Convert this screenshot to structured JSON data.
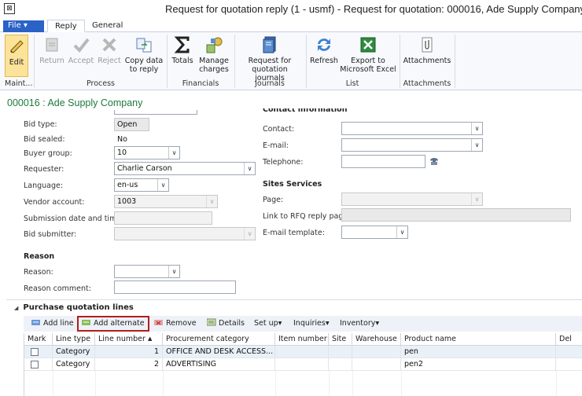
{
  "window": {
    "title": "Request for quotation reply (1 - usmf) - Request for quotation: 000016, Ade Supply Company",
    "sys_icon": "⊠"
  },
  "ribbon_tabs": {
    "file": "File",
    "file_arrow": "▾",
    "reply": "Reply",
    "general": "General"
  },
  "ribbon": {
    "edit": "Edit",
    "return": "Return",
    "accept": "Accept",
    "reject": "Reject",
    "copy_data": "Copy data",
    "copy_data_2": "to reply",
    "totals": "Totals",
    "manage": "Manage",
    "manage_2": "charges",
    "rfq_journals": "Request for",
    "rfq_journals_2": "quotation journals",
    "refresh": "Refresh",
    "export": "Export to",
    "export_2": "Microsoft Excel",
    "attachments": "Attachments",
    "groups": {
      "maint": "Maint...",
      "process": "Process",
      "financials": "Financials",
      "journals": "Journals",
      "list": "List",
      "attachments": "Attachments"
    }
  },
  "record_header": "000016 : Ade Supply Company",
  "form": {
    "bid_type_label": "Bid type:",
    "bid_type": "Open",
    "bid_sealed_label": "Bid sealed:",
    "bid_sealed": "No",
    "buyer_group_label": "Buyer group:",
    "buyer_group": "10",
    "requester_label": "Requester:",
    "requester": "Charlie Carson",
    "language_label": "Language:",
    "language": "en-us",
    "vendor_account_label": "Vendor account:",
    "vendor_account": "1003",
    "submission_label": "Submission date and time:",
    "submission": "",
    "bid_submitter_label": "Bid submitter:",
    "bid_submitter": "",
    "reason_section": "Reason",
    "reason_label": "Reason:",
    "reason": "",
    "reason_comment_label": "Reason comment:",
    "reason_comment": "",
    "contact_section": "Contact information",
    "contact_label": "Contact:",
    "contact": "",
    "email_label": "E-mail:",
    "email": "",
    "telephone_label": "Telephone:",
    "telephone": "",
    "sites_section": "Sites Services",
    "page_label": "Page:",
    "page": "",
    "link_label": "Link to RFQ reply page:",
    "link": "",
    "email_template_label": "E-mail template:",
    "email_template": "",
    "dropdown_arrow": "∨"
  },
  "lines": {
    "section_title": "Purchase quotation lines",
    "collapse_glyph": "◢",
    "toolbar": {
      "add_line": "Add line",
      "add_alternate": "Add alternate",
      "remove": "Remove",
      "details": "Details",
      "setup": "Set up",
      "inquiries": "Inquiries",
      "inventory": "Inventory",
      "menu_arrow": "▾"
    },
    "columns": [
      "Mark",
      "Line type",
      "Line number",
      "Procurement category",
      "Item number",
      "Site",
      "Warehouse",
      "Product name",
      "Del"
    ],
    "sort_indicator": "▲",
    "rows": [
      {
        "line_type": "Category",
        "line_number": "1",
        "category": "OFFICE AND DESK ACCESS...",
        "item": "",
        "site": "",
        "warehouse": "",
        "product": "pen"
      },
      {
        "line_type": "Category",
        "line_number": "2",
        "category": "ADVERTISING",
        "item": "",
        "site": "",
        "warehouse": "",
        "product": "pen2"
      }
    ]
  }
}
